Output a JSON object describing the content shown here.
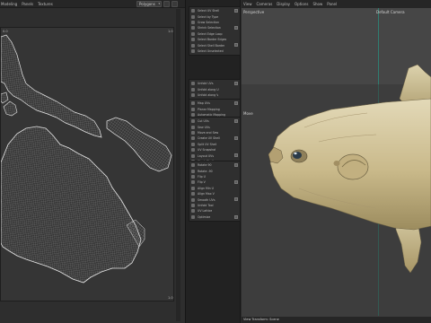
{
  "uv_editor": {
    "menu": [
      "Modeling",
      "Panels",
      "Textures"
    ],
    "dropdown_value": "Polygons",
    "corner_top_left": "0.0",
    "corner_top_right": "1.0",
    "corner_bottom_right": "1.0"
  },
  "tools_panel": {
    "groups": [
      [
        "Select UV Shell",
        "Select by Type",
        "Grow Selection",
        "Shrink Selection",
        "Select Edge Loop",
        "Select Border Edges",
        "Select Shell Border",
        "Select Unselected"
      ],
      [
        "Unfold UVs",
        "Unfold along U",
        "Unfold along V",
        "Straighten UVs"
      ],
      [
        "Map UVs",
        "Planar Mapping",
        "Automatic Mapping"
      ],
      [
        "Cut UVs",
        "Sew UVs",
        "Move and Sew",
        "Create UV Shell",
        "Split UV Shell",
        "UV Snapshot",
        "Layout UVs",
        "Stack Shells",
        "Orient Shells",
        "Normalize",
        "Distribute Shells"
      ],
      [
        "Rotate 90",
        "Rotate -90",
        "Flip U",
        "Flip V",
        "Align Min U",
        "Align Max V",
        "Smooth UVs",
        "Unfold Tool",
        "UV Lattice",
        "Optimize"
      ]
    ]
  },
  "viewport": {
    "menu": [
      "View",
      "Cameras",
      "Display",
      "Options",
      "Show",
      "Panel"
    ],
    "view_name": "Perspective",
    "camera_label": "Default Camera",
    "mode_label": "Move",
    "status_text": "View Transform: Scene",
    "background_color": "#404040",
    "model_color": "#c9b98a"
  }
}
